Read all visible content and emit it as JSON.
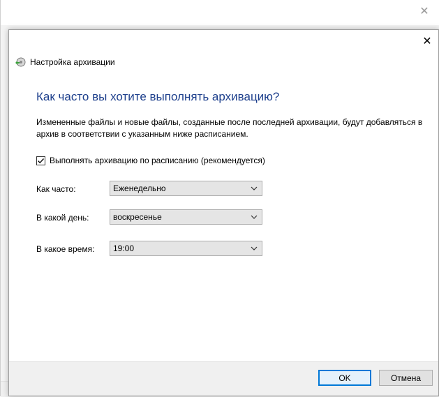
{
  "dialog": {
    "window_title": "Настройка архивации",
    "heading": "Как часто вы хотите выполнять архивацию?",
    "description": "Измененные файлы и новые файлы, созданные после последней архивации, будут добавляться в архив в соответствии с указанным ниже расписанием.",
    "schedule_checkbox": {
      "label": "Выполнять архивацию по расписанию (рекомендуется)",
      "checked": true
    },
    "fields": [
      {
        "label": "Как часто:",
        "value": "Еженедельно"
      },
      {
        "label": "В какой день:",
        "value": "воскресенье"
      },
      {
        "label": "В какое время:",
        "value": "19:00"
      }
    ],
    "buttons": {
      "ok": "OK",
      "cancel": "Отмена"
    }
  },
  "icons": {
    "close": "close-icon",
    "app": "backup-settings-icon",
    "dropdown": "chevron-down-icon",
    "check": "check-icon"
  },
  "colors": {
    "heading": "#1d3f8c",
    "default_button_border": "#0078d7",
    "footer_bg": "#f0f0f0",
    "combo_bg": "#e5e5e5"
  }
}
